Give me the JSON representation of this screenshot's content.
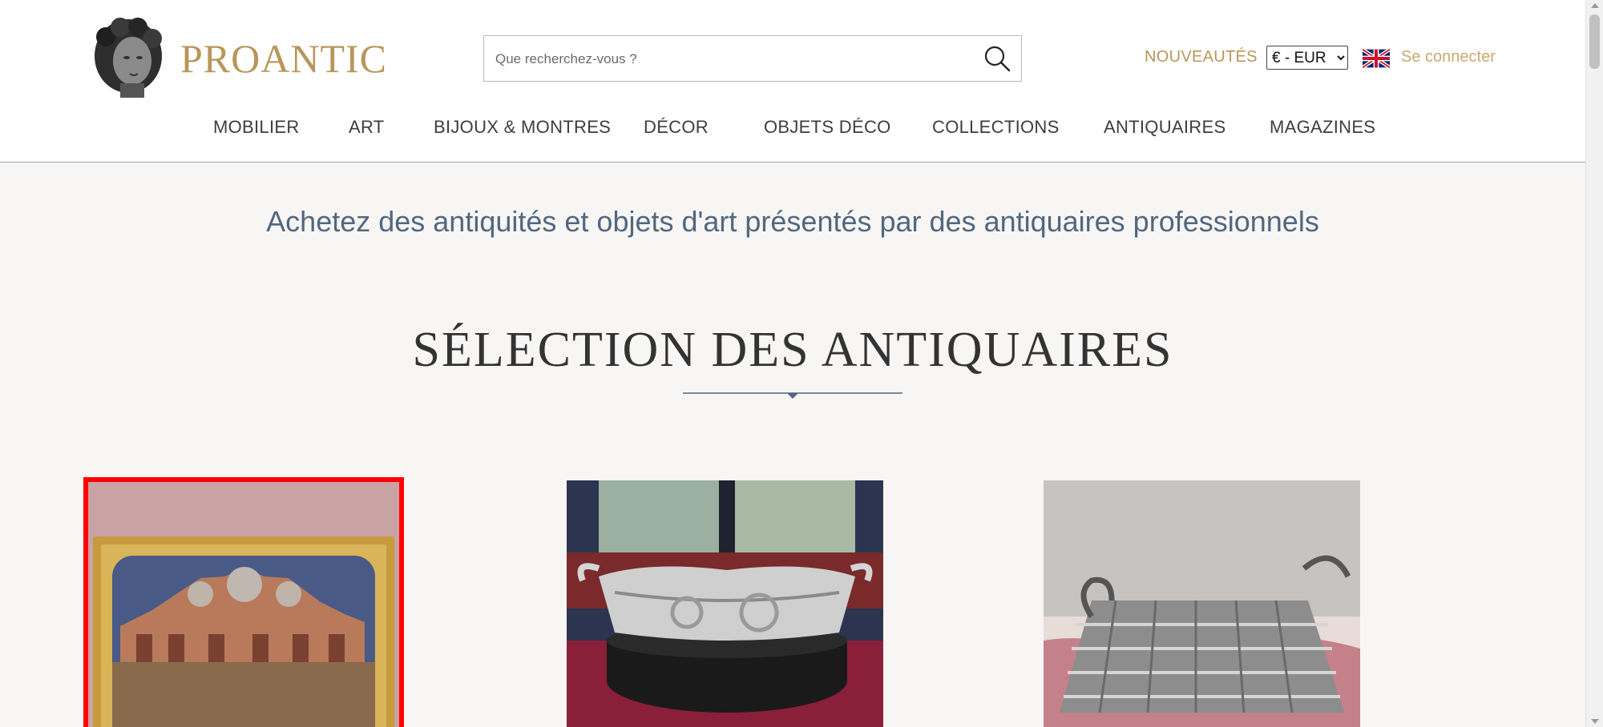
{
  "brand": {
    "name": "PROANTIC",
    "logo_icon": "bust-icon",
    "color": "#b8965a"
  },
  "search": {
    "placeholder": "Que recherchez-vous ?",
    "icon": "search-icon"
  },
  "header_links": {
    "new": "NOUVEAUTÉS",
    "login": "Se connecter"
  },
  "currency": {
    "selected": "€ - EUR"
  },
  "language": {
    "flag": "uk-flag-icon"
  },
  "nav": {
    "items": [
      "MOBILIER",
      "ART",
      "BIJOUX & MONTRES",
      "DÉCOR",
      "OBJETS DÉCO",
      "COLLECTIONS",
      "ANTIQUAIRES",
      "MAGAZINES"
    ]
  },
  "main": {
    "tagline": "Achetez des antiquités et objets d'art présentés par des antiquaires professionnels",
    "section_title": "SÉLECTION DES ANTIQUAIRES"
  },
  "colors": {
    "accent": "#b8965a",
    "tagline": "#52677f",
    "highlight_border": "#ff0000"
  }
}
